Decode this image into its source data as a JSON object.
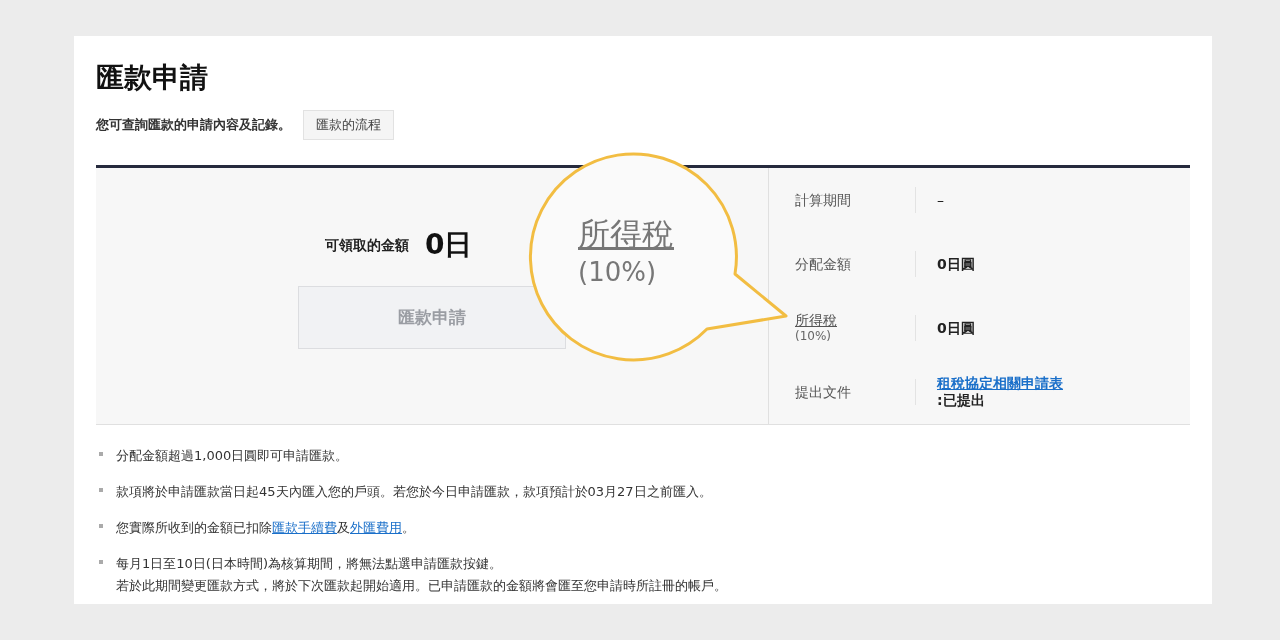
{
  "title": "匯款申請",
  "subtitle": "您可查詢匯款的申請內容及記錄。",
  "flow_button": "匯款的流程",
  "summary": {
    "label": "可領取的金額",
    "amount": "0日",
    "apply_button": {
      "label": "匯款申請",
      "disabled": true
    }
  },
  "callout": {
    "label": "所得稅",
    "rate": "(10%)"
  },
  "details": [
    {
      "label": "計算期間",
      "value": "–",
      "kind": "plain"
    },
    {
      "label": "分配金額",
      "value": "0日圓",
      "kind": "plain"
    },
    {
      "label": "所得稅",
      "sublabel": "(10%)",
      "value": "0日圓",
      "kind": "tax"
    },
    {
      "label": "提出文件",
      "value": "租稅協定相關申請表",
      "note": ":已提出",
      "kind": "document"
    }
  ],
  "notes": [
    {
      "parts": [
        {
          "kind": "text",
          "text": "分配金額超過1,000日圓即可申請匯款。"
        }
      ]
    },
    {
      "parts": [
        {
          "kind": "text",
          "text": "款項將於申請匯款當日起45天內匯入您的戶頭。若您於今日申請匯款，款項預計於03月27日之前匯入。"
        }
      ]
    },
    {
      "parts": [
        {
          "kind": "text",
          "text": "您實際所收到的金額已扣除"
        },
        {
          "kind": "link",
          "text": "匯款手續費"
        },
        {
          "kind": "text",
          "text": "及"
        },
        {
          "kind": "link",
          "text": "外匯費用"
        },
        {
          "kind": "text",
          "text": "。"
        }
      ]
    },
    {
      "parts": [
        {
          "kind": "text",
          "text": "每月1日至10日(日本時間)為核算期間，將無法點選申請匯款按鍵。"
        },
        {
          "kind": "break"
        },
        {
          "kind": "text",
          "text": "若於此期間變更匯款方式，將於下次匯款起開始適用。已申請匯款的金額將會匯至您申請時所註冊的帳戶。"
        }
      ]
    }
  ]
}
